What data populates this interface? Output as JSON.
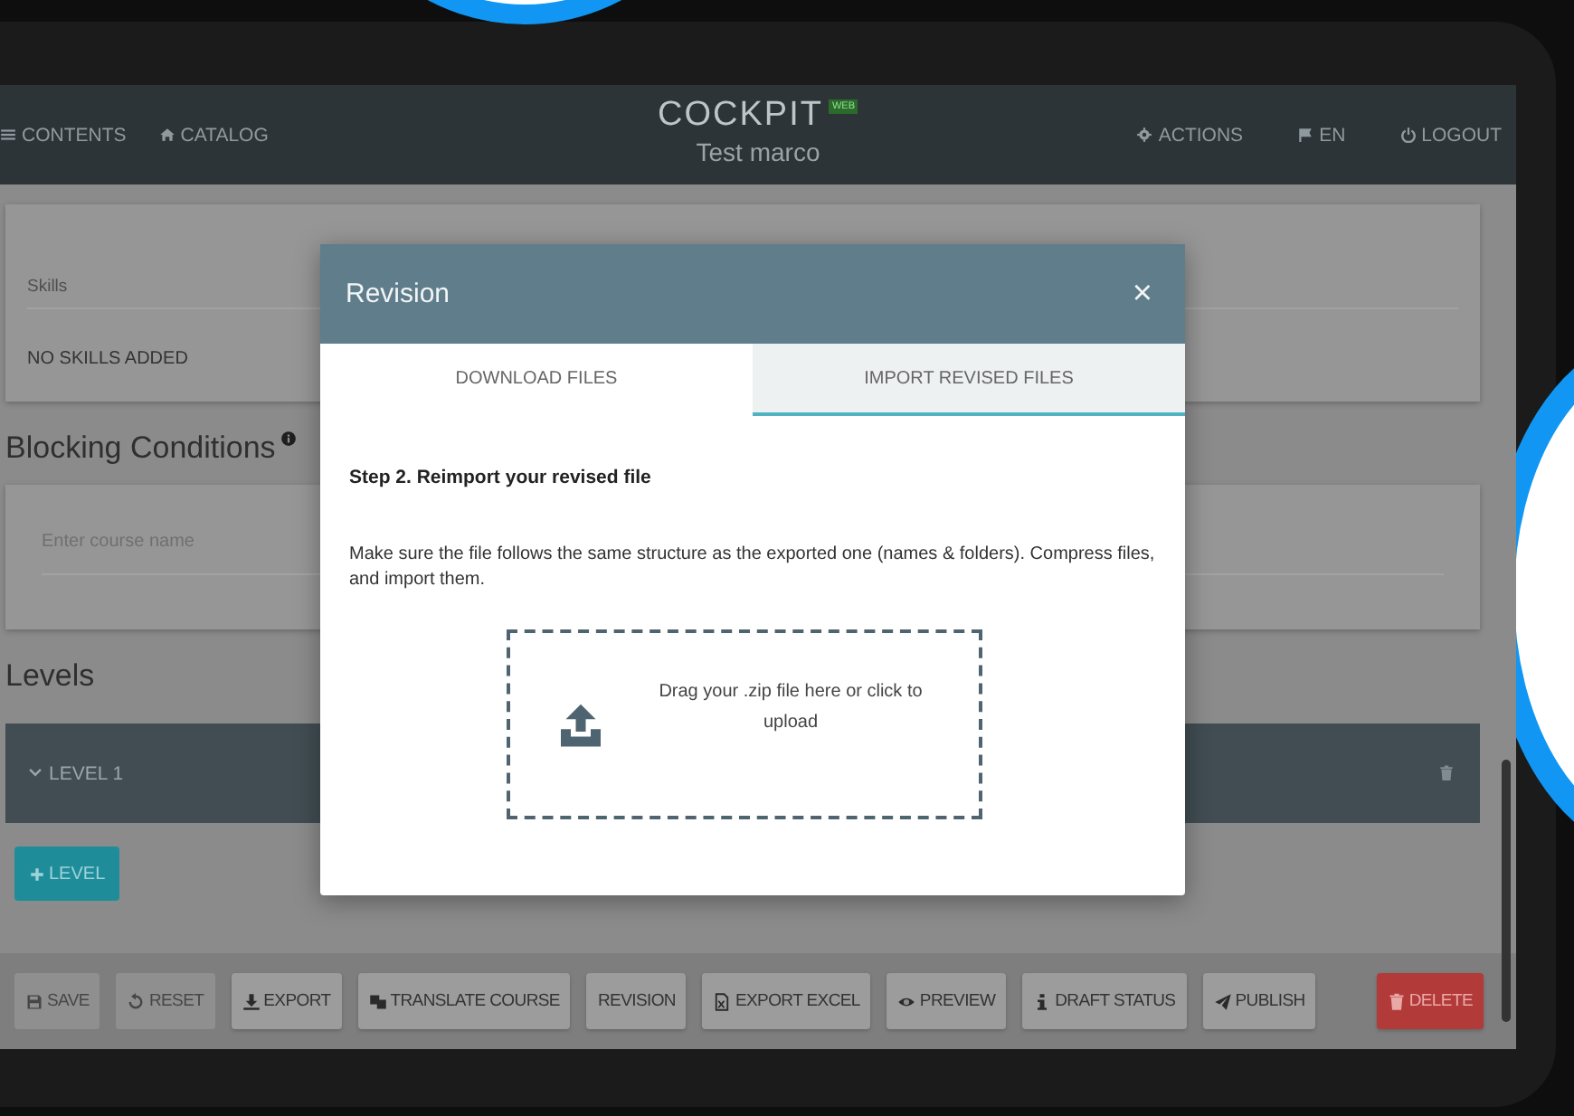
{
  "header": {
    "left_nav": [
      {
        "kind": "menu",
        "label": "CONTENTS"
      },
      {
        "kind": "home",
        "label": "CATALOG"
      }
    ],
    "logo": {
      "title": "COCKPIT",
      "badge": "WEB",
      "subtitle": "Test marco"
    },
    "right_nav": [
      {
        "kind": "gear",
        "label": "ACTIONS"
      },
      {
        "kind": "flag",
        "label": "EN"
      },
      {
        "kind": "power",
        "label": "LOGOUT"
      }
    ]
  },
  "skills": {
    "placeholder": "Skills",
    "empty_text": "NO SKILLS ADDED"
  },
  "blocking_conditions": {
    "heading": "Blocking Conditions",
    "field_placeholder": "Enter course name"
  },
  "levels": {
    "heading": "Levels",
    "items": [
      {
        "label": "LEVEL 1",
        "expanded": true
      }
    ],
    "add_button": "LEVEL"
  },
  "toolbar": {
    "buttons": [
      {
        "kind": "save",
        "label": "SAVE",
        "disabled": true
      },
      {
        "kind": "reset",
        "label": "RESET",
        "disabled": true
      },
      {
        "kind": "export",
        "label": "EXPORT",
        "disabled": false
      },
      {
        "kind": "translate",
        "label": "TRANSLATE COURSE",
        "disabled": false
      },
      {
        "kind": "plain",
        "label": "REVISION",
        "disabled": false
      },
      {
        "kind": "excel",
        "label": "EXPORT EXCEL",
        "disabled": false
      },
      {
        "kind": "preview",
        "label": "PREVIEW",
        "disabled": false
      },
      {
        "kind": "info",
        "label": "DRAFT STATUS",
        "disabled": false
      },
      {
        "kind": "publish",
        "label": "PUBLISH",
        "disabled": false
      },
      {
        "kind": "delete",
        "label": "DELETE",
        "disabled": false
      }
    ]
  },
  "modal": {
    "title": "Revision",
    "close": "×",
    "tabs": [
      {
        "label": "DOWNLOAD FILES",
        "selected": false
      },
      {
        "label": "IMPORT REVISED FILES",
        "selected": true
      }
    ],
    "step_title": "Step 2. Reimport your revised file",
    "description": "Make sure the file follows the same structure as the exported one (names & folders). Compress files, and import them.",
    "dropzone_text": "Drag your .zip file here or click to upload"
  }
}
